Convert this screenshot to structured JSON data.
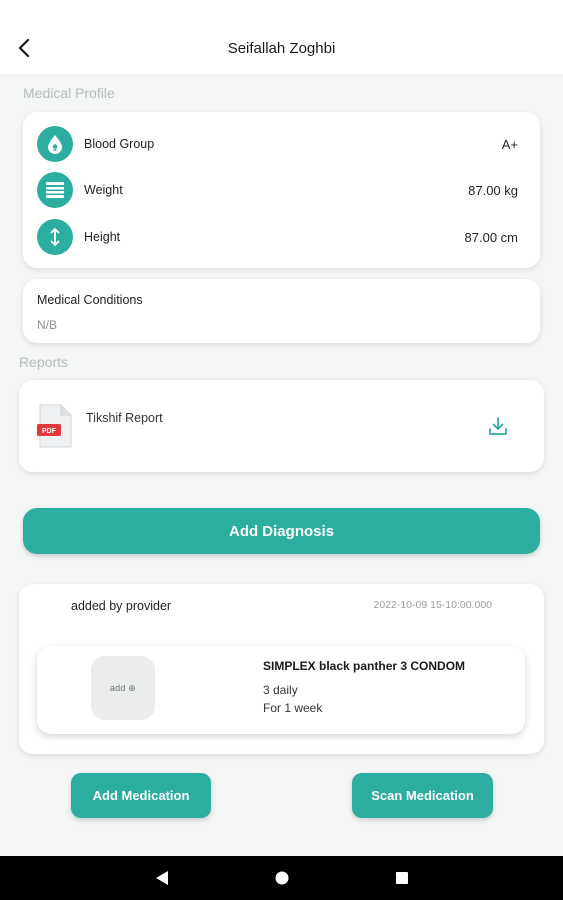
{
  "header": {
    "title": "Seifallah Zoghbi"
  },
  "medical_profile": {
    "section_label": "Medical Profile",
    "stats": [
      {
        "label": "Blood Group",
        "value": "A+",
        "icon": "blood-drop-icon"
      },
      {
        "label": "Weight",
        "value": "87.00 kg",
        "icon": "weight-scale-icon"
      },
      {
        "label": "Height",
        "value": "87.00 cm",
        "icon": "height-arrows-icon"
      }
    ],
    "conditions": {
      "title": "Medical Conditions",
      "value": "N/B"
    }
  },
  "reports": {
    "section_label": "Reports",
    "items": [
      {
        "name": "Tikshif Report",
        "file_badge": "PDF"
      }
    ]
  },
  "add_diagnosis_label": "Add Diagnosis",
  "diagnosis": {
    "added_by": "added by provider",
    "date": "2022-10-09  15-10:00.000",
    "medication": {
      "thumbnail_text": "add ⊕",
      "name": "SIMPLEX black panther 3 CONDOM",
      "dose": "3 daily",
      "duration": "For 1 week"
    }
  },
  "actions": {
    "add_medication": "Add Medication",
    "scan_medication": "Scan Medication"
  },
  "theme": {
    "accent": "#2bada0",
    "navbar": "#000000"
  }
}
